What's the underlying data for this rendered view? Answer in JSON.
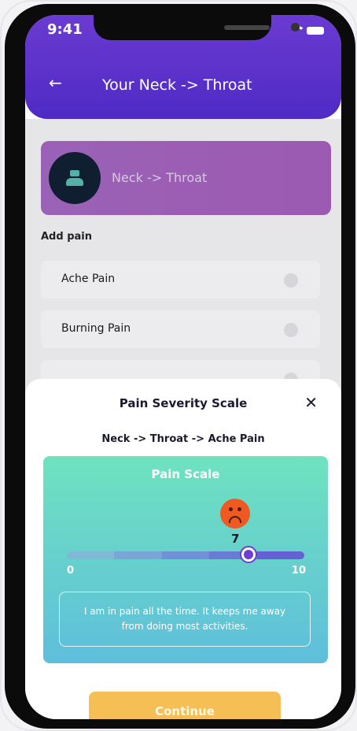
{
  "status_bar": {
    "time": "9:41"
  },
  "header": {
    "title": "Your Neck -> Throat"
  },
  "region_card": {
    "label": "Neck -> Throat"
  },
  "add_pain": {
    "heading": "Add pain",
    "items": [
      {
        "label": "Ache Pain"
      },
      {
        "label": "Burning Pain"
      }
    ]
  },
  "sheet": {
    "title": "Pain Severity Scale",
    "subtitle": "Neck -> Throat -> Ache Pain",
    "scale": {
      "title": "Pain Scale",
      "value": "7",
      "min": "0",
      "max": "10",
      "level_fraction": 0.7,
      "description": "I am in pain all the time. It keeps me away from doing most activities."
    },
    "continue_label": "Continue"
  },
  "colors": {
    "header": "#5b33cc",
    "accent": "#6b3fd1",
    "continue": "#f5bf55",
    "face": "#f05a22"
  }
}
